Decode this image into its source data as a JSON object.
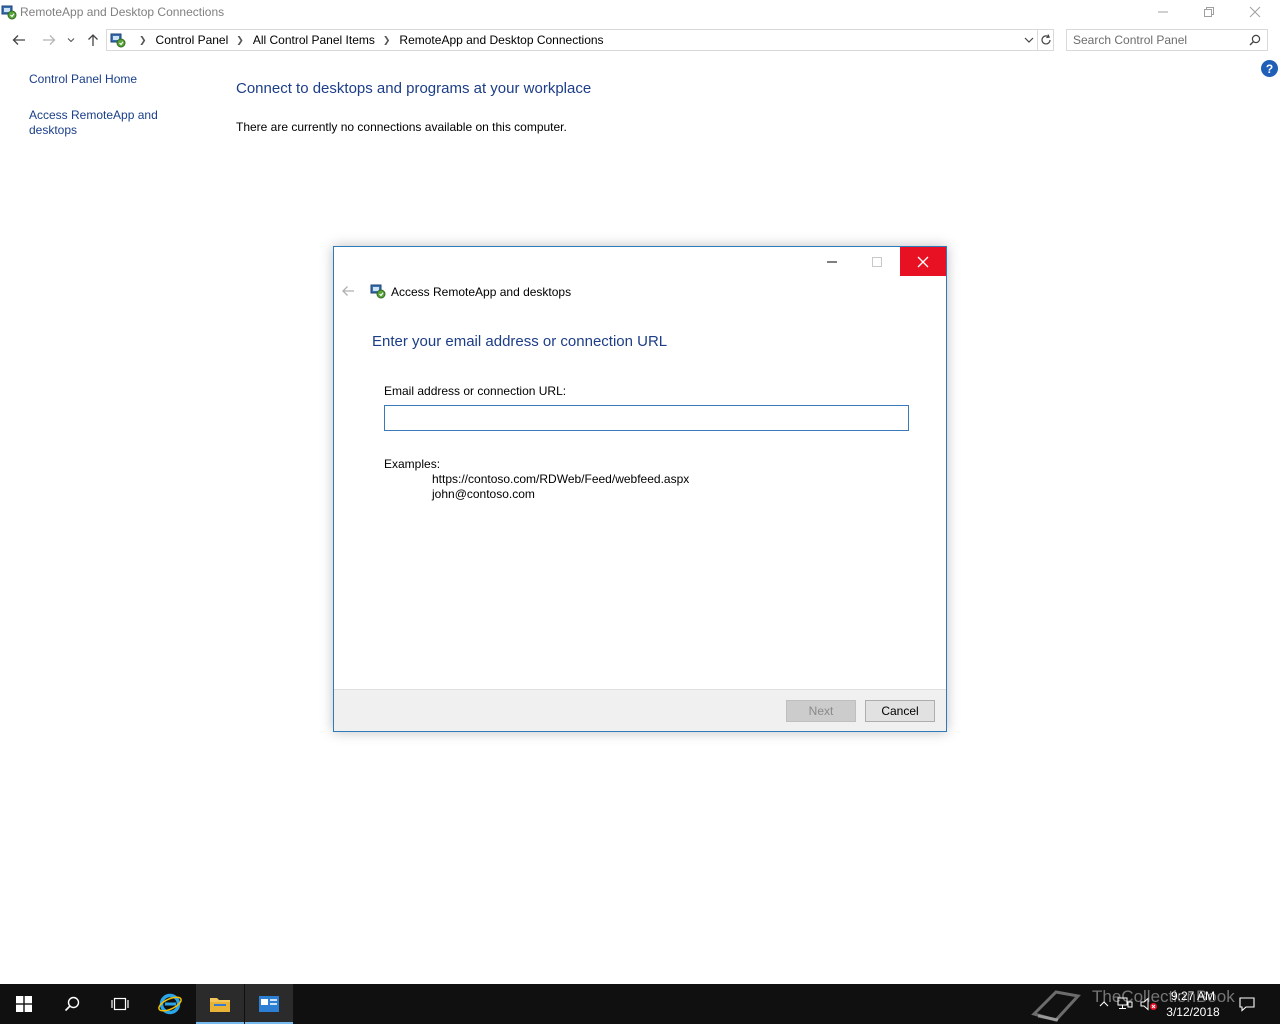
{
  "window": {
    "title": "RemoteApp and Desktop Connections"
  },
  "address": {
    "crumbs": [
      "Control Panel",
      "All Control Panel Items",
      "RemoteApp and Desktop Connections"
    ]
  },
  "search": {
    "placeholder": "Search Control Panel"
  },
  "sidebar": {
    "items": [
      {
        "label": "Control Panel Home"
      },
      {
        "label": "Access RemoteApp and desktops"
      }
    ]
  },
  "main": {
    "heading": "Connect to desktops and programs at your workplace",
    "message": "There are currently no connections available on this computer."
  },
  "dialog": {
    "title": "Access RemoteApp and desktops",
    "heading": "Enter your email address or connection URL",
    "field_label": "Email address or connection URL:",
    "field_value": "",
    "examples_label": "Examples:",
    "examples": [
      "https://contoso.com/RDWeb/Feed/webfeed.aspx",
      "john@contoso.com"
    ],
    "next_label": "Next",
    "cancel_label": "Cancel"
  },
  "taskbar": {
    "clock_time": "9:27 AM",
    "clock_date": "3/12/2018",
    "watermark": "TheCollectionBook"
  },
  "colors": {
    "accent": "#1c3d87",
    "close_red": "#e81123",
    "taskbar": "#101010",
    "taskbar_active": "#76b9ed"
  }
}
